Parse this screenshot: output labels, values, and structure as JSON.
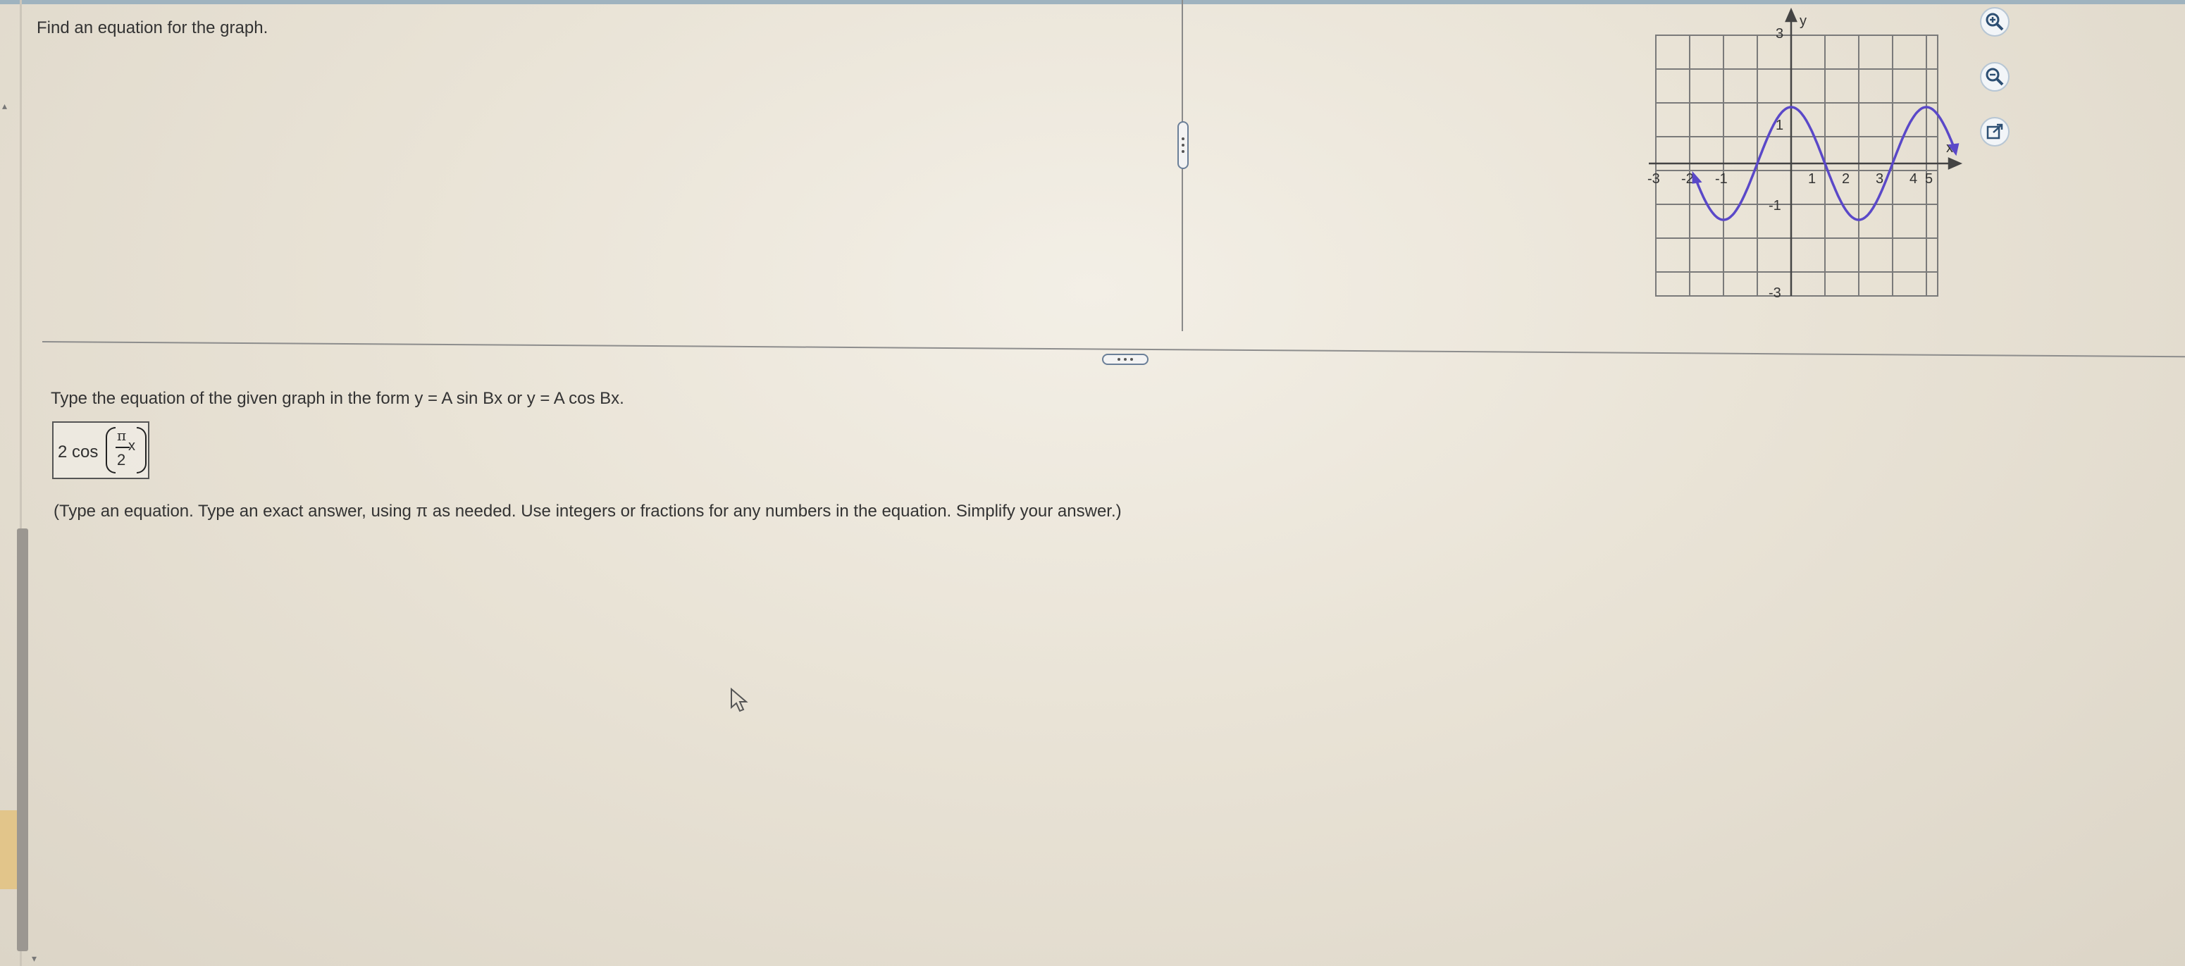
{
  "prompt": "Find an equation for the graph.",
  "instruction": {
    "prefix": "Type the equation of the given graph in the form ",
    "form1": "y = A sin Bx",
    "connector": " or ",
    "form2": "y = A cos Bx",
    "suffix": "."
  },
  "answer": {
    "coefficient": "2 cos",
    "numerator": "π",
    "denominator": "2",
    "variable": "x"
  },
  "help_text": "(Type an equation. Type an exact answer, using π as needed. Use integers or fractions for any numbers in the equation. Simplify your answer.)",
  "tools": [
    "zoom-in-icon",
    "zoom-out-icon",
    "external-link-icon"
  ],
  "graph": {
    "x_axis_label": "x",
    "y_axis_label": "y",
    "x_ticks": [
      "-3",
      "-2",
      "-1",
      "1",
      "2",
      "3",
      "4",
      "5"
    ],
    "y_ticks": [
      "3",
      "1",
      "-1",
      "-3"
    ],
    "curve_color": "#5a48c8",
    "grid_color": "#7a7a7a"
  }
}
